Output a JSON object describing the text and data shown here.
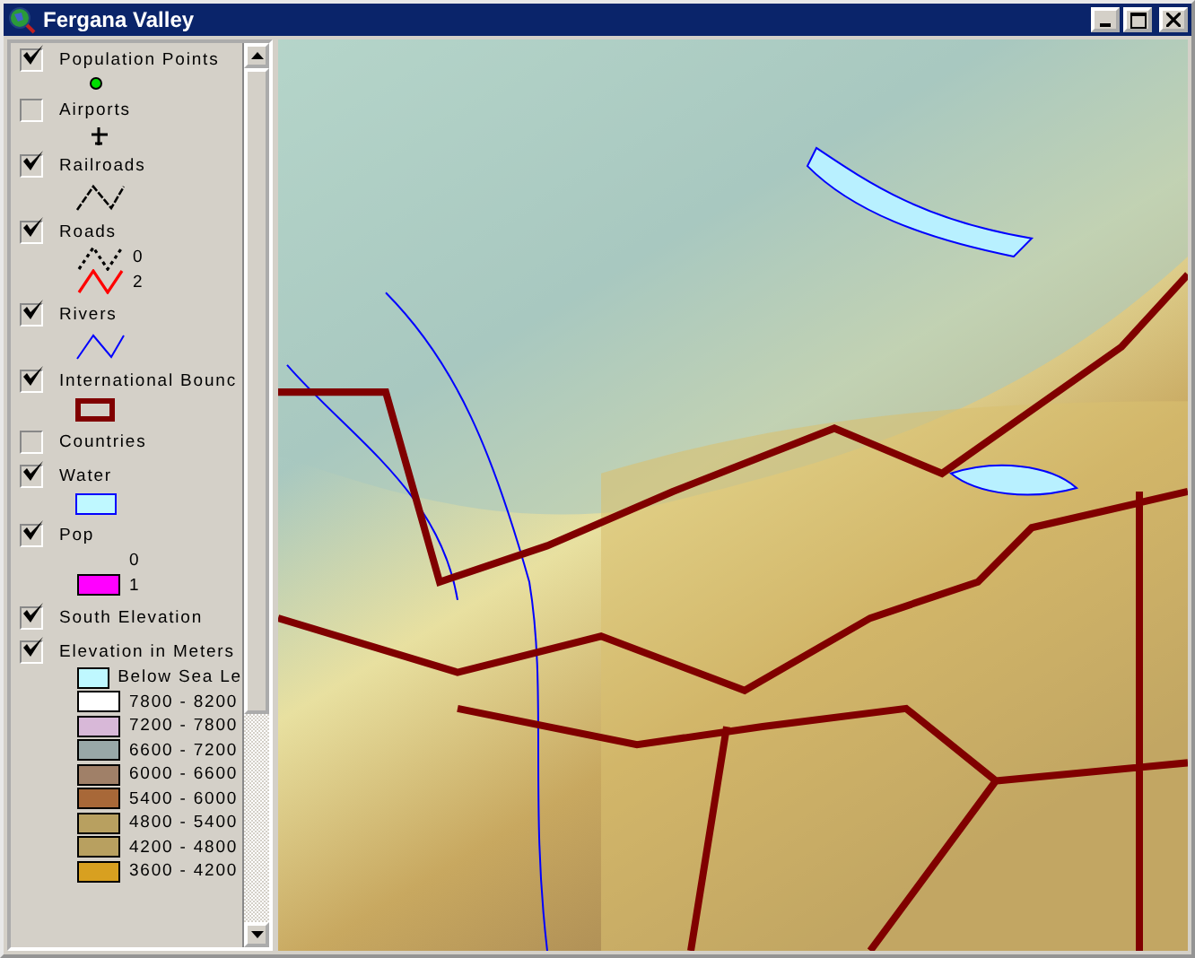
{
  "window": {
    "title": "Fergana Valley"
  },
  "layers": [
    {
      "label": "Population Points",
      "checked": true,
      "kind": "point"
    },
    {
      "label": "Airports",
      "checked": false,
      "kind": "airport"
    },
    {
      "label": "Railroads",
      "checked": true,
      "kind": "rail"
    },
    {
      "label": "Roads",
      "checked": true,
      "kind": "roads",
      "classes": [
        {
          "label": "0",
          "color": "#000000"
        },
        {
          "label": "2",
          "color": "#ff0000"
        }
      ]
    },
    {
      "label": "Rivers",
      "checked": true,
      "kind": "river"
    },
    {
      "label": "International Bounc",
      "checked": true,
      "kind": "boundary"
    },
    {
      "label": "Countries",
      "checked": false,
      "kind": "none"
    },
    {
      "label": "Water",
      "checked": true,
      "kind": "water"
    },
    {
      "label": "Pop",
      "checked": true,
      "kind": "pop",
      "classes": [
        {
          "label": "0"
        },
        {
          "label": "1",
          "color": "#ff00ff"
        }
      ]
    },
    {
      "label": "South Elevation",
      "checked": true,
      "kind": "none"
    },
    {
      "label": "Elevation in Meters",
      "checked": true,
      "kind": "ramp",
      "classes": [
        {
          "label": "Below Sea Le",
          "color": "#bff8ff"
        },
        {
          "label": "7800 - 8200",
          "color": "#ffffff"
        },
        {
          "label": "7200 - 7800",
          "color": "#d8b8d8"
        },
        {
          "label": "6600 - 7200",
          "color": "#98a8a8"
        },
        {
          "label": "6000 - 6600",
          "color": "#a08068"
        },
        {
          "label": "5400 - 6000",
          "color": "#a86838"
        },
        {
          "label": "4800 - 5400",
          "color": "#b8a060"
        },
        {
          "label": "4200 - 4800",
          "color": "#b8a060"
        },
        {
          "label": "3600 - 4200",
          "color": "#d8a020"
        }
      ]
    }
  ]
}
